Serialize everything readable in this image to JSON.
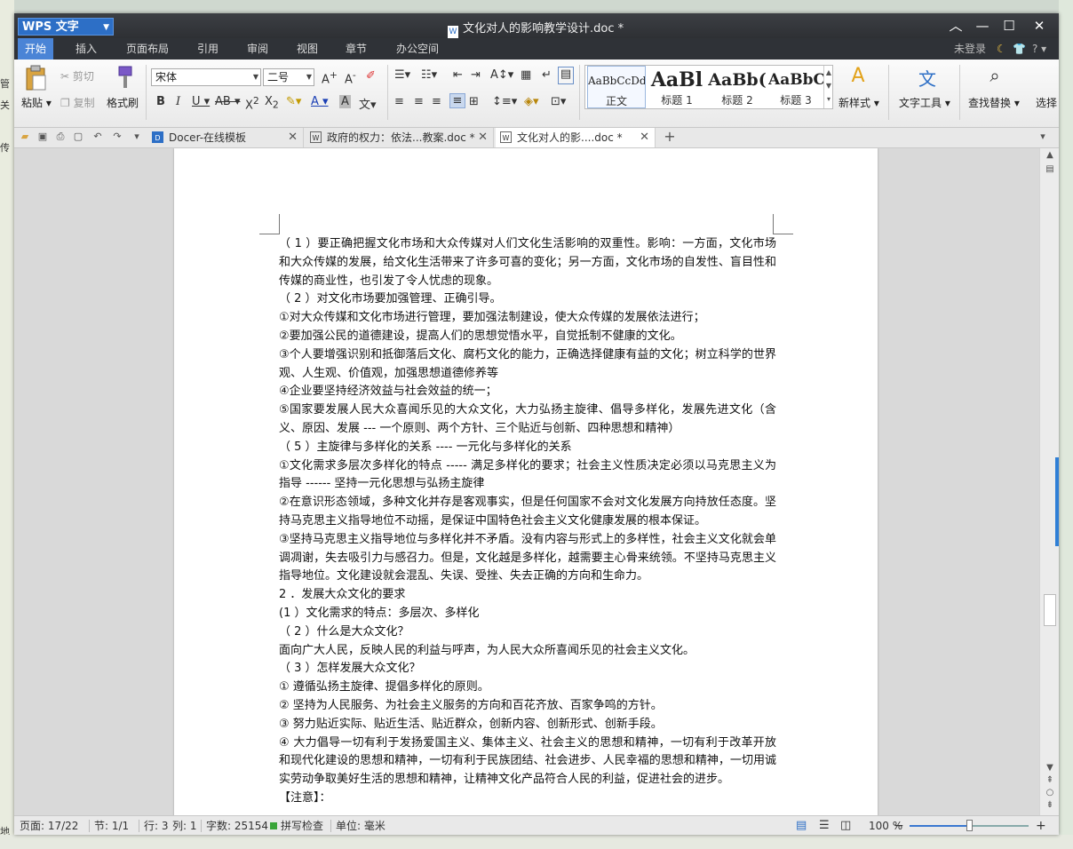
{
  "app": {
    "name": "WPS 文字",
    "doc_title": "文化对人的影响教学设计.doc *"
  },
  "bg": {
    "left_labels": [
      "管",
      "关",
      "传"
    ],
    "bottom_left": "地"
  },
  "menu": {
    "tabs": [
      "开始",
      "插入",
      "页面布局",
      "引用",
      "审阅",
      "视图",
      "章节",
      "办公空间"
    ],
    "login": "未登录"
  },
  "ribbon": {
    "paste": "粘贴",
    "cut": "剪切",
    "copy": "复制",
    "format_painter": "格式刷",
    "font_name": "宋体",
    "font_size": "二号",
    "new_style": "新样式",
    "text_tools": "文字工具",
    "find_replace": "查找替换",
    "select": "选择",
    "styles": [
      {
        "preview": "AaBbCcDd",
        "name": "正文"
      },
      {
        "preview": "AaBl",
        "name": "标题 1"
      },
      {
        "preview": "AaBb(",
        "name": "标题 2"
      },
      {
        "preview": "AaBbC",
        "name": "标题 3"
      }
    ]
  },
  "tabs": [
    {
      "label": "Docer-在线模板"
    },
    {
      "label": "政府的权力：依法...教案.doc *"
    },
    {
      "label": "文化对人的影....doc *"
    }
  ],
  "document": {
    "paragraphs": [
      "（ 1 ）要正确把握文化市场和大众传媒对人们文化生活影响的双重性。影响：一方面，文化市场和大众传媒的发展，给文化生活带来了许多可喜的变化；另一方面，文化市场的自发性、盲目性和传媒的商业性，也引发了令人忧虑的现象。",
      "（ 2 ）对文化市场要加强管理、正确引导。",
      "①对大众传媒和文化市场进行管理，要加强法制建设，使大众传媒的发展依法进行；",
      "②要加强公民的道德建设，提高人们的思想觉悟水平，自觉抵制不健康的文化。",
      "③个人要增强识别和抵御落后文化、腐朽文化的能力，正确选择健康有益的文化；树立科学的世界观、人生观、价值观，加强思想道德修养等",
      "④企业要坚持经济效益与社会效益的统一；",
      "⑤国家要发展人民大众喜闻乐见的大众文化，大力弘扬主旋律、倡导多样化，发展先进文化（含义、原因、发展 --- 一个原则、两个方针、三个贴近与创新、四种思想和精神）",
      "（ 5 ）主旋律与多样化的关系 ---- 一元化与多样化的关系",
      "①文化需求多层次多样化的特点 ----- 满足多样化的要求；社会主义性质决定必须以马克思主义为指导 ------ 坚持一元化思想与弘扬主旋律",
      "②在意识形态领域，多种文化并存是客观事实，但是任何国家不会对文化发展方向持放任态度。坚持马克思主义指导地位不动摇，是保证中国特色社会主义文化健康发展的根本保证。",
      "③坚持马克思主义指导地位与多样化并不矛盾。没有内容与形式上的多样性，社会主义文化就会单调凋谢，失去吸引力与感召力。但是，文化越是多样化，越需要主心骨来统领。不坚持马克思主义指导地位。文化建设就会混乱、失误、受挫、失去正确的方向和生命力。",
      "2 ．发展大众文化的要求",
      "(1 ）文化需求的特点：多层次、多样化",
      "（ 2 ）什么是大众文化？",
      "面向广大人民，反映人民的利益与呼声，为人民大众所喜闻乐见的社会主义文化。",
      "（ 3 ）怎样发展大众文化？",
      "①  遵循弘扬主旋律、提倡多样化的原则。",
      "②  坚持为人民服务、为社会主义服务的方向和百花齐放、百家争鸣的方针。",
      "③  努力贴近实际、贴近生活、贴近群众，创新内容、创新形式、创新手段。",
      "④  大力倡导一切有利于发扬爱国主义、集体主义、社会主义的思想和精神，一切有利于改革开放和现代化建设的思想和精神，一切有利于民族团结、社会进步、人民幸福的思想和精神，一切用诚实劳动争取美好生活的思想和精神，让精神文化产品符合人民的利益，促进社会的进步。",
      "【注意】："
    ]
  },
  "status": {
    "page": "页面: 17/22",
    "section": "节: 1/1",
    "row": "行: 3",
    "col": "列: 1",
    "words": "字数: 25154",
    "spell": "拼写检查",
    "unit": "单位: 毫米",
    "zoom": "100 %",
    "zoom_fraction": 0.5
  }
}
